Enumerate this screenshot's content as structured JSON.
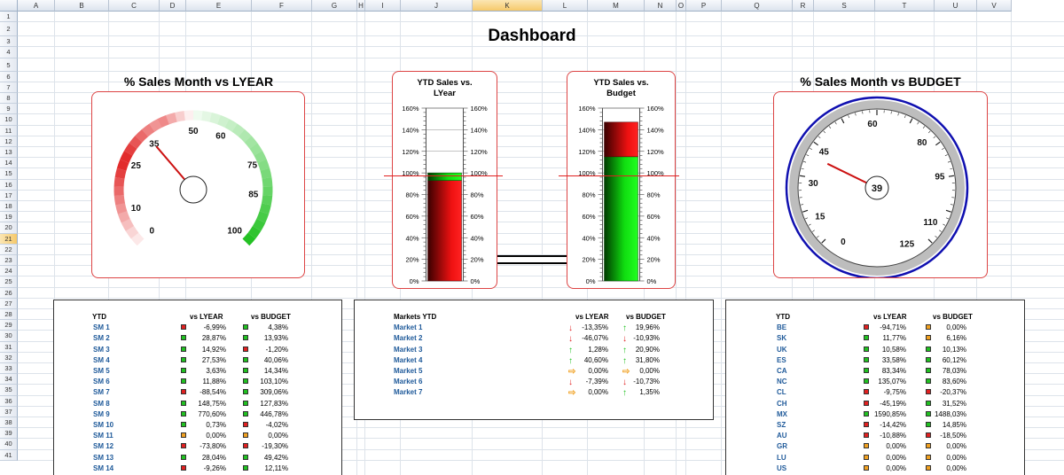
{
  "sheet": {
    "columns": [
      "A",
      "B",
      "C",
      "D",
      "E",
      "F",
      "G",
      "H",
      "I",
      "J",
      "K",
      "L",
      "M",
      "N",
      "O",
      "P",
      "Q",
      "R",
      "S",
      "T",
      "U",
      "V"
    ],
    "selected_column": "K",
    "selected_row": "21",
    "title": "Dashboard"
  },
  "gauge_lyear": {
    "title": "% Sales Month vs LYEAR",
    "ticks": [
      "0",
      "10",
      "25",
      "35",
      "50",
      "60",
      "75",
      "85",
      "100"
    ],
    "value": 35
  },
  "gauge_budget": {
    "title": "% Sales Month vs BUDGET",
    "ticks": [
      "0",
      "15",
      "30",
      "45",
      "60",
      "80",
      "95",
      "110",
      "125"
    ],
    "value": 39,
    "value_label": "39"
  },
  "bar_lyear": {
    "title_line1": "YTD Sales vs.",
    "title_line2": "LYear",
    "axis": [
      "160%",
      "140%",
      "120%",
      "100%",
      "80%",
      "60%",
      "40%",
      "20%",
      "0%"
    ],
    "value": 93,
    "target": 100
  },
  "bar_budget": {
    "title_line1": "YTD Sales vs.",
    "title_line2": "Budget",
    "axis": [
      "160%",
      "140%",
      "120%",
      "100%",
      "80%",
      "60%",
      "40%",
      "20%",
      "0%"
    ],
    "value": 147,
    "target": 115
  },
  "colors": {
    "red": "#e02020",
    "green": "#20c020",
    "amber": "#f0a020",
    "gauge_ring_blue": "#1010b0",
    "link": "#1f5a9a"
  },
  "table_sm": {
    "headers": [
      "YTD",
      "vs LYEAR",
      "vs BUDGET"
    ],
    "rows": [
      {
        "label": "SM 1",
        "lyear": "-6,99%",
        "lyear_status": "red",
        "budget": "4,38%",
        "budget_status": "green"
      },
      {
        "label": "SM 2",
        "lyear": "28,87%",
        "lyear_status": "green",
        "budget": "13,93%",
        "budget_status": "green"
      },
      {
        "label": "SM 3",
        "lyear": "14,92%",
        "lyear_status": "green",
        "budget": "-1,20%",
        "budget_status": "red"
      },
      {
        "label": "SM 4",
        "lyear": "27,53%",
        "lyear_status": "green",
        "budget": "40,06%",
        "budget_status": "green"
      },
      {
        "label": "SM 5",
        "lyear": "3,63%",
        "lyear_status": "green",
        "budget": "14,34%",
        "budget_status": "green"
      },
      {
        "label": "SM 6",
        "lyear": "11,88%",
        "lyear_status": "green",
        "budget": "103,10%",
        "budget_status": "green"
      },
      {
        "label": "SM 7",
        "lyear": "-88,54%",
        "lyear_status": "red",
        "budget": "309,06%",
        "budget_status": "green"
      },
      {
        "label": "SM 8",
        "lyear": "148,75%",
        "lyear_status": "green",
        "budget": "127,83%",
        "budget_status": "green"
      },
      {
        "label": "SM 9",
        "lyear": "770,60%",
        "lyear_status": "green",
        "budget": "446,78%",
        "budget_status": "green"
      },
      {
        "label": "SM 10",
        "lyear": "0,73%",
        "lyear_status": "green",
        "budget": "-4,02%",
        "budget_status": "red"
      },
      {
        "label": "SM 11",
        "lyear": "0,00%",
        "lyear_status": "amber",
        "budget": "0,00%",
        "budget_status": "amber"
      },
      {
        "label": "SM 12",
        "lyear": "-73,80%",
        "lyear_status": "red",
        "budget": "-19,30%",
        "budget_status": "red"
      },
      {
        "label": "SM 13",
        "lyear": "28,04%",
        "lyear_status": "green",
        "budget": "49,42%",
        "budget_status": "green"
      },
      {
        "label": "SM 14",
        "lyear": "-9,26%",
        "lyear_status": "red",
        "budget": "12,11%",
        "budget_status": "green"
      }
    ]
  },
  "table_markets": {
    "headers": [
      "Markets  YTD",
      "vs LYEAR",
      "vs BUDGET"
    ],
    "rows": [
      {
        "label": "Market 1",
        "lyear": "-13,35%",
        "lyear_dir": "down",
        "budget": "19,96%",
        "budget_dir": "up"
      },
      {
        "label": "Market 2",
        "lyear": "-46,07%",
        "lyear_dir": "down",
        "budget": "-10,93%",
        "budget_dir": "down"
      },
      {
        "label": "Market 3",
        "lyear": "1,28%",
        "lyear_dir": "up",
        "budget": "20,90%",
        "budget_dir": "up"
      },
      {
        "label": "Market 4",
        "lyear": "40,60%",
        "lyear_dir": "up",
        "budget": "31,80%",
        "budget_dir": "up"
      },
      {
        "label": "Market 5",
        "lyear": "0,00%",
        "lyear_dir": "side",
        "budget": "0,00%",
        "budget_dir": "side"
      },
      {
        "label": "Market 6",
        "lyear": "-7,39%",
        "lyear_dir": "down",
        "budget": "-10,73%",
        "budget_dir": "down"
      },
      {
        "label": "Market 7",
        "lyear": "0,00%",
        "lyear_dir": "side",
        "budget": "1,35%",
        "budget_dir": "up"
      }
    ]
  },
  "table_countries": {
    "headers": [
      "YTD",
      "vs LYEAR",
      "vs BUDGET"
    ],
    "rows": [
      {
        "label": "BE",
        "lyear": "-94,71%",
        "lyear_status": "red",
        "budget": "0,00%",
        "budget_status": "amber"
      },
      {
        "label": "SK",
        "lyear": "11,77%",
        "lyear_status": "green",
        "budget": "6,16%",
        "budget_status": "amber"
      },
      {
        "label": "UK",
        "lyear": "10,58%",
        "lyear_status": "green",
        "budget": "10,13%",
        "budget_status": "green"
      },
      {
        "label": "ES",
        "lyear": "33,58%",
        "lyear_status": "green",
        "budget": "60,12%",
        "budget_status": "green"
      },
      {
        "label": "CA",
        "lyear": "83,34%",
        "lyear_status": "green",
        "budget": "78,03%",
        "budget_status": "green"
      },
      {
        "label": "NC",
        "lyear": "135,07%",
        "lyear_status": "green",
        "budget": "83,60%",
        "budget_status": "green"
      },
      {
        "label": "CL",
        "lyear": "-9,75%",
        "lyear_status": "red",
        "budget": "-20,37%",
        "budget_status": "red"
      },
      {
        "label": "CH",
        "lyear": "-45,19%",
        "lyear_status": "red",
        "budget": "31,52%",
        "budget_status": "green"
      },
      {
        "label": "MX",
        "lyear": "1590,85%",
        "lyear_status": "green",
        "budget": "1488,03%",
        "budget_status": "green"
      },
      {
        "label": "SZ",
        "lyear": "-14,42%",
        "lyear_status": "red",
        "budget": "14,85%",
        "budget_status": "green"
      },
      {
        "label": "AU",
        "lyear": "-10,88%",
        "lyear_status": "red",
        "budget": "-18,50%",
        "budget_status": "red"
      },
      {
        "label": "GR",
        "lyear": "0,00%",
        "lyear_status": "amber",
        "budget": "0,00%",
        "budget_status": "amber"
      },
      {
        "label": "LU",
        "lyear": "0,00%",
        "lyear_status": "amber",
        "budget": "0,00%",
        "budget_status": "amber"
      },
      {
        "label": "US",
        "lyear": "0,00%",
        "lyear_status": "amber",
        "budget": "0,00%",
        "budget_status": "amber"
      }
    ]
  }
}
